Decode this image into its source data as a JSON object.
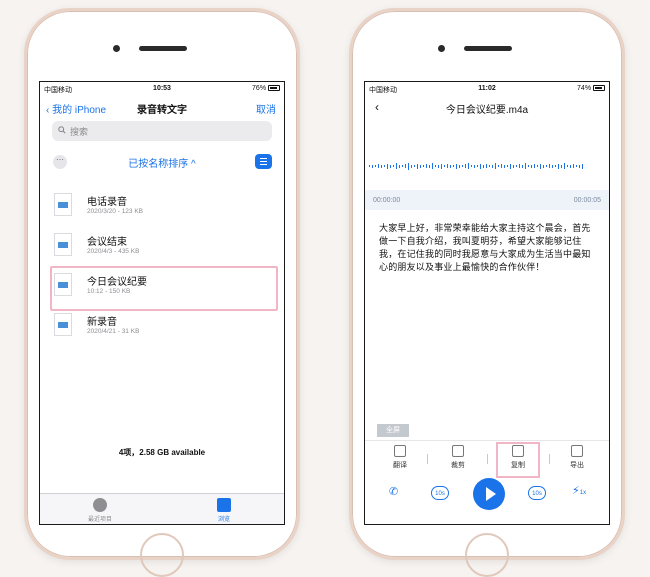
{
  "left": {
    "status": {
      "carrier": "中国移动",
      "time": "10:53",
      "battery": "76%"
    },
    "nav": {
      "back_label": "我的 iPhone",
      "title": "录音转文字",
      "cancel_label": "取消"
    },
    "search": {
      "placeholder": "搜索"
    },
    "sort": {
      "label": "已按名称排序 ^"
    },
    "files": [
      {
        "name": "电话录音",
        "meta": "2020/3/20 - 123 KB"
      },
      {
        "name": "会议结束",
        "meta": "2020/4/3 - 435 KB"
      },
      {
        "name": "今日会议纪要",
        "meta": "10:12 - 150 KB"
      },
      {
        "name": "新录音",
        "meta": "2020/4/21 - 31 KB"
      }
    ],
    "storage": "4项，2.58 GB available",
    "tabs": [
      {
        "label": "最近项目"
      },
      {
        "label": "浏览"
      }
    ]
  },
  "right": {
    "status": {
      "carrier": "中国移动",
      "time": "11:02",
      "battery": "74%"
    },
    "nav": {
      "title": "今日会议纪要.m4a"
    },
    "times": {
      "start": "00:00:00",
      "end": "00:00:05"
    },
    "transcript": "大家早上好，非常荣幸能给大家主持这个晨会，首先做一下自我介绍，我叫夏明芬，希望大家能够记住我，在记住我的同时我愿意与大家成为生活当中最知心的朋友以及事业上最愉快的合作伙伴！",
    "fullscreen_label": "全屏",
    "tools": [
      {
        "label": "翻译"
      },
      {
        "label": "裁剪"
      },
      {
        "label": "复制"
      },
      {
        "label": "导出"
      }
    ],
    "player": {
      "skip_back": "10s",
      "skip_forward": "10s",
      "speed": "1x"
    }
  },
  "colors": {
    "accent": "#1a73e8",
    "highlight": "#f0b6c6",
    "frame": "#e9d2c6"
  }
}
